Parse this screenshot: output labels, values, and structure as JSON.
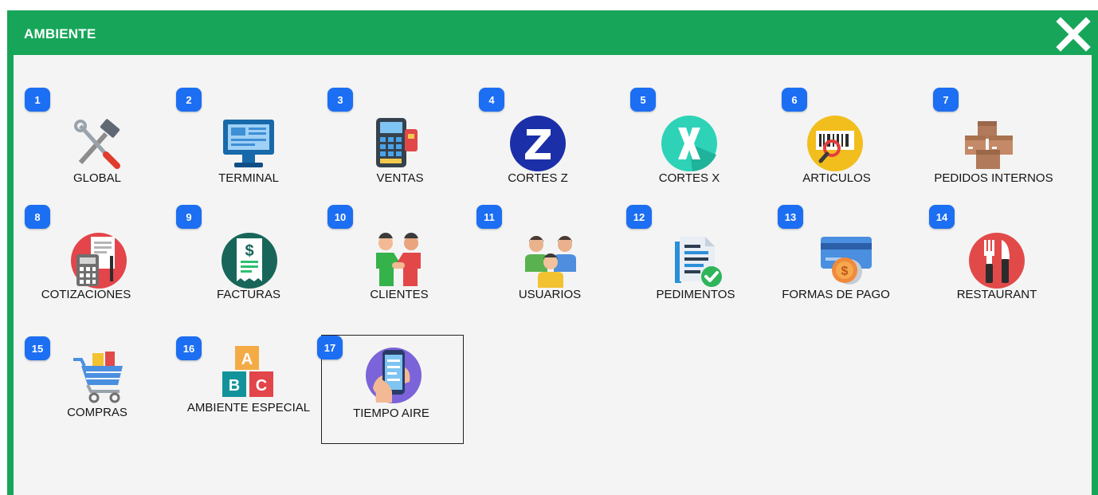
{
  "window": {
    "title": "AMBIENTE",
    "close_icon": "close-icon",
    "colors": {
      "titlebar": "#17a659",
      "panel": "#f4f4f4",
      "badge": "#1c6ef2"
    }
  },
  "tiles": [
    {
      "number": "1",
      "label": "GLOBAL",
      "icon": "tools-icon"
    },
    {
      "number": "2",
      "label": "TERMINAL",
      "icon": "monitor-icon"
    },
    {
      "number": "3",
      "label": "VENTAS",
      "icon": "card-terminal-icon"
    },
    {
      "number": "4",
      "label": "CORTES Z",
      "icon": "z-circle-icon"
    },
    {
      "number": "5",
      "label": "CORTES X",
      "icon": "x-circle-icon"
    },
    {
      "number": "6",
      "label": "ARTICULOS",
      "icon": "barcode-search-icon"
    },
    {
      "number": "7",
      "label": "PEDIDOS INTERNOS",
      "icon": "boxes-icon"
    },
    {
      "number": "8",
      "label": "COTIZACIONES",
      "icon": "calculator-document-icon"
    },
    {
      "number": "9",
      "label": "FACTURAS",
      "icon": "receipt-icon"
    },
    {
      "number": "10",
      "label": "CLIENTES",
      "icon": "handshake-icon"
    },
    {
      "number": "11",
      "label": "USUARIOS",
      "icon": "users-icon"
    },
    {
      "number": "12",
      "label": "PEDIMENTOS",
      "icon": "document-check-icon"
    },
    {
      "number": "13",
      "label": "FORMAS DE PAGO",
      "icon": "card-coin-icon"
    },
    {
      "number": "14",
      "label": "RESTAURANT",
      "icon": "cutlery-icon"
    },
    {
      "number": "15",
      "label": "COMPRAS",
      "icon": "shopping-cart-icon"
    },
    {
      "number": "16",
      "label": "AMBIENTE ESPECIAL",
      "icon": "abc-blocks-icon"
    },
    {
      "number": "17",
      "label": "TIEMPO AIRE",
      "icon": "phone-in-hand-icon",
      "selected": true
    }
  ]
}
